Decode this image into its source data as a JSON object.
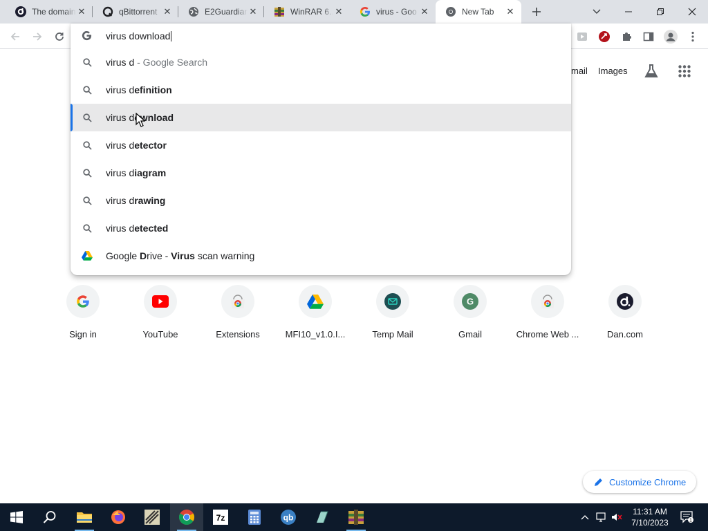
{
  "tabs": [
    {
      "title": "The domain",
      "icon": "dan-logo-icon"
    },
    {
      "title": "qBittorrent",
      "icon": "qbittorrent-icon"
    },
    {
      "title": "E2Guardian",
      "icon": "globe-icon"
    },
    {
      "title": "WinRAR 6...",
      "icon": "winrar-icon"
    },
    {
      "title": "virus - Goo",
      "icon": "google-icon"
    },
    {
      "title": "New Tab",
      "icon": "chrome-icon"
    }
  ],
  "omnibox": {
    "value": "virus download",
    "suggestions": [
      {
        "prefix": "virus d",
        "bold": "",
        "suffix": " - Google Search",
        "icon": "search-icon"
      },
      {
        "prefix": "virus d",
        "bold": "efinition",
        "suffix": "",
        "icon": "search-icon"
      },
      {
        "prefix": "virus d",
        "bold": "ownload",
        "suffix": "",
        "icon": "search-icon"
      },
      {
        "prefix": "virus d",
        "bold": "etector",
        "suffix": "",
        "icon": "search-icon"
      },
      {
        "prefix": "virus d",
        "bold": "iagram",
        "suffix": "",
        "icon": "search-icon"
      },
      {
        "prefix": "virus d",
        "bold": "rawing",
        "suffix": "",
        "icon": "search-icon"
      },
      {
        "prefix": "virus d",
        "bold": "etected",
        "suffix": "",
        "icon": "search-icon"
      }
    ],
    "drive_suggestion": {
      "part1": "Google ",
      "bold1": "D",
      "part2": "rive - ",
      "bold2": "Virus",
      "part3": " scan warning"
    }
  },
  "ntp": {
    "gmail_label": "mail",
    "images_label": "Images",
    "shortcuts": [
      {
        "label": "Sign in",
        "icon": "google-g-icon"
      },
      {
        "label": "YouTube",
        "icon": "youtube-icon"
      },
      {
        "label": "Extensions",
        "icon": "chrome-web-store-icon"
      },
      {
        "label": "MFI10_v1.0.I...",
        "icon": "google-drive-icon"
      },
      {
        "label": "Temp Mail",
        "icon": "temp-mail-icon"
      },
      {
        "label": "Gmail",
        "icon": "letter-g-avatar-icon"
      },
      {
        "label": "Chrome Web ...",
        "icon": "chrome-web-store-icon"
      },
      {
        "label": "Dan.com",
        "icon": "dan-logo-icon"
      }
    ],
    "gmail_avatar_letter": "G",
    "customize_label": "Customize Chrome"
  },
  "taskbar": {
    "time": "11:31 AM",
    "date": "7/10/2023",
    "notification_count": "1"
  },
  "colors": {
    "accent": "#1a73e8",
    "tabstrip": "#dee1e6",
    "taskbar": "#0d1a2b"
  }
}
